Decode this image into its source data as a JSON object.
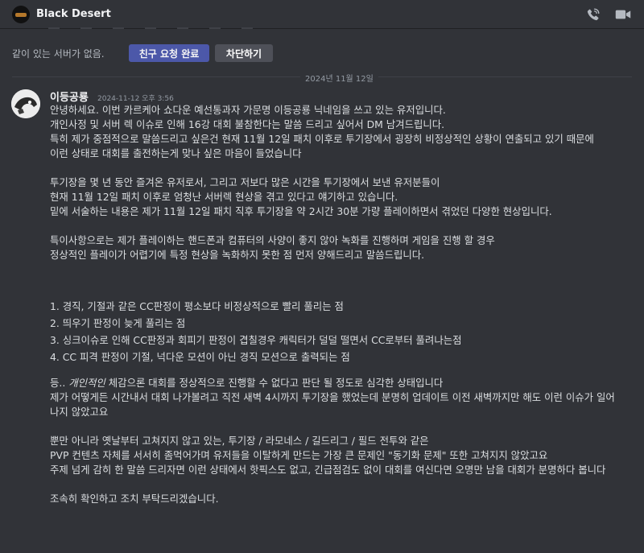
{
  "header": {
    "title": "Black Desert",
    "call_icon": "phone-call-icon",
    "video_icon": "video-camera-icon"
  },
  "friend_bar": {
    "no_server_text": "같이 있는 서버가 없음.",
    "friend_request_label": "친구 요청 완료",
    "block_label": "차단하기"
  },
  "divider": {
    "date": "2024년 11월 12일"
  },
  "message": {
    "author": "이등공룡",
    "timestamp": "2024-11-12 오후 3:56",
    "lines": {
      "l1": "안녕하세요. 이번 카르케아 쇼다운 예선통과자 가문명 이등공룡 닉네임을 쓰고 있는 유저입니다.",
      "l2": "개인사정 및 서버 렉 이슈로 인해 16강 대회 불참한다는 말씀 드리고 싶어서 DM 남겨드립니다.",
      "l3": "특히 제가 중점적으로 말씀드리고 싶은건 현재 11월 12일 패치 이후로 투기장에서 굉장히 비정상적인 상황이 연출되고 있기 때문에",
      "l4": "이런 상태로 대회를 출전하는게 맞나 싶은 마음이 들었습니다",
      "l5": "투기장을 몇 년 동안 즐겨온 유저로서, 그리고 저보다 많은 시간을 투기장에서 보낸 유저분들이",
      "l6": "현재 11월 12일 패치 이후로 엄청난 서버렉 현상을 겪고 있다고 얘기하고 있습니다.",
      "l7": "밑에 서술하는 내용은 제가 11월 12일 패치 직후 투기장을 약 2시간 30분 가량 플레이하면서 겪었던 다양한 현상입니다.",
      "l8": "특이사항으로는 제가 플레이하는 핸드폰과 컴퓨터의 사양이 좋지 않아 녹화를 진행하며 게임을 진행 할 경우",
      "l9": "정상적인 플레이가 어렵기에 특정 현상을 녹화하지 못한 점 먼저 양해드리고 말씀드립니다.",
      "item1": "1. 경직, 기절과 같은 CC판정이 평소보다 비정상적으로 빨리 풀리는 점",
      "item2": "2. 띄우기 판정이 늦게 풀리는 점",
      "item3": "3. 싱크이슈로 인해 CC판정과 회피기 판정이 겹칠경우 캐릭터가 덜덜 떨면서 CC로부터 풀려나는점",
      "item4": "4. CC 피격 판정이 기절, 넉다운 모션이 아닌 경직 모션으로 출력되는 점",
      "l10_a": "등.. ",
      "l10_b": "개인적인",
      "l10_c": " 체감으론 대회를 정상적으로 진행할 수 없다고 판단 될 정도로 심각한 상태입니다",
      "l11": "제가 어떻게든 시간내서 대회 나가볼려고 직전 새벽 4시까지 투기장을 했었는데 분명히 업데이트 이전 새벽까지만 해도 이런 이슈가 일어나지 않았고요",
      "l12": "뿐만 아니라 옛날부터 고쳐지지 않고 있는, 투기장 / 라모네스 / 길드리그 / 필드 전투와 같은",
      "l13": "PVP 컨텐츠 자체를 서서히 좀먹어가며 유저들을 이탈하게 만드는 가장 큰 문제인 \"동기화 문제\" 또한 고쳐지지 않았고요",
      "l14": "주제 넘게 감히 한 말씀 드리자면 이런 상태에서 핫픽스도 없고, 긴급점검도 없이 대회를 여신다면 오명만 남을 대회가 분명하다 봅니다",
      "l15": "조속히 확인하고 조치 부탁드리겠습니다."
    }
  }
}
